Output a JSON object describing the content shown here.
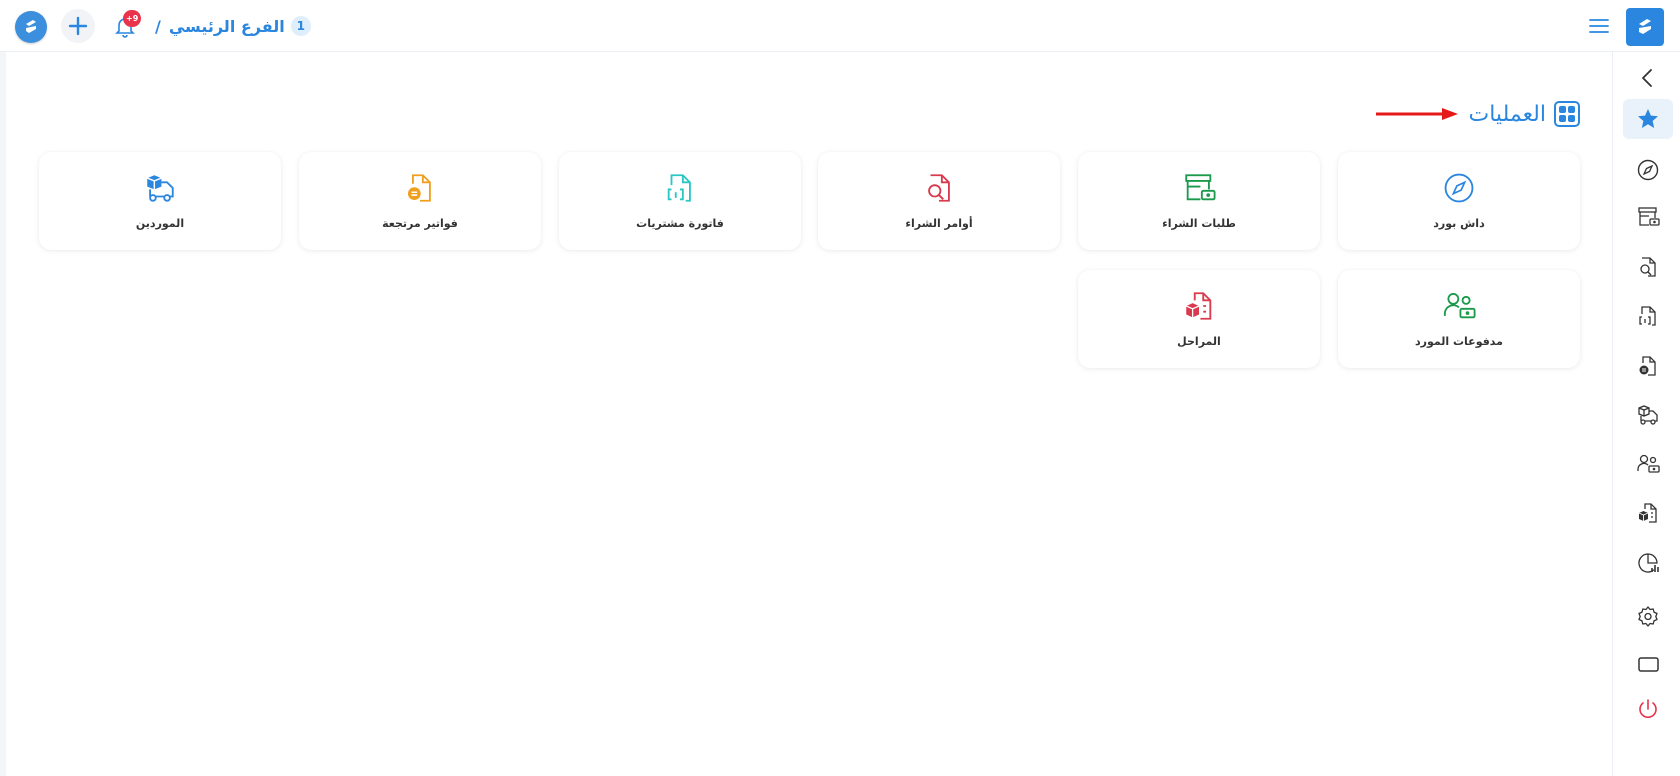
{
  "topbar": {
    "branch_number": "1",
    "branch_name": "الفرع الرئيسي",
    "separator": "/",
    "notification_badge": "+9",
    "colors": {
      "accent": "#2a86df",
      "badge": "#e8334a"
    }
  },
  "section": {
    "title": "العمليات",
    "icon": "grid-icon"
  },
  "cards": [
    {
      "label": "داش بورد",
      "icon": "compass-icon",
      "color": "#2a86df"
    },
    {
      "label": "طلبات الشراء",
      "icon": "store-cash-icon",
      "color": "#1a9a4a"
    },
    {
      "label": "أوامر الشراء",
      "icon": "file-search-icon",
      "color": "#d93a4e"
    },
    {
      "label": "فاتورة مشتريات",
      "icon": "file-code-icon",
      "color": "#2ac6c6"
    },
    {
      "label": "فواتير مرتجعة",
      "icon": "file-return-icon",
      "color": "#f0a020"
    },
    {
      "label": "الموردين",
      "icon": "truck-box-icon",
      "color": "#2a86df"
    },
    {
      "label": "مدفوعات المورد",
      "icon": "users-cash-icon",
      "color": "#1a9a4a"
    },
    {
      "label": "المراحل",
      "icon": "file-box-icon",
      "color": "#d93a4e"
    }
  ],
  "sidebar": {
    "items": [
      {
        "icon": "chevron-left-icon"
      },
      {
        "icon": "star-icon",
        "active": true
      },
      {
        "icon": "compass-icon"
      },
      {
        "icon": "store-cash-icon"
      },
      {
        "icon": "file-search-icon"
      },
      {
        "icon": "file-code-icon"
      },
      {
        "icon": "file-return-icon"
      },
      {
        "icon": "truck-box-icon"
      },
      {
        "icon": "users-cash-icon"
      },
      {
        "icon": "file-box-icon"
      },
      {
        "icon": "chart-icon"
      },
      {
        "icon": "gear-icon"
      },
      {
        "icon": "screen-icon"
      },
      {
        "icon": "power-icon"
      }
    ]
  }
}
